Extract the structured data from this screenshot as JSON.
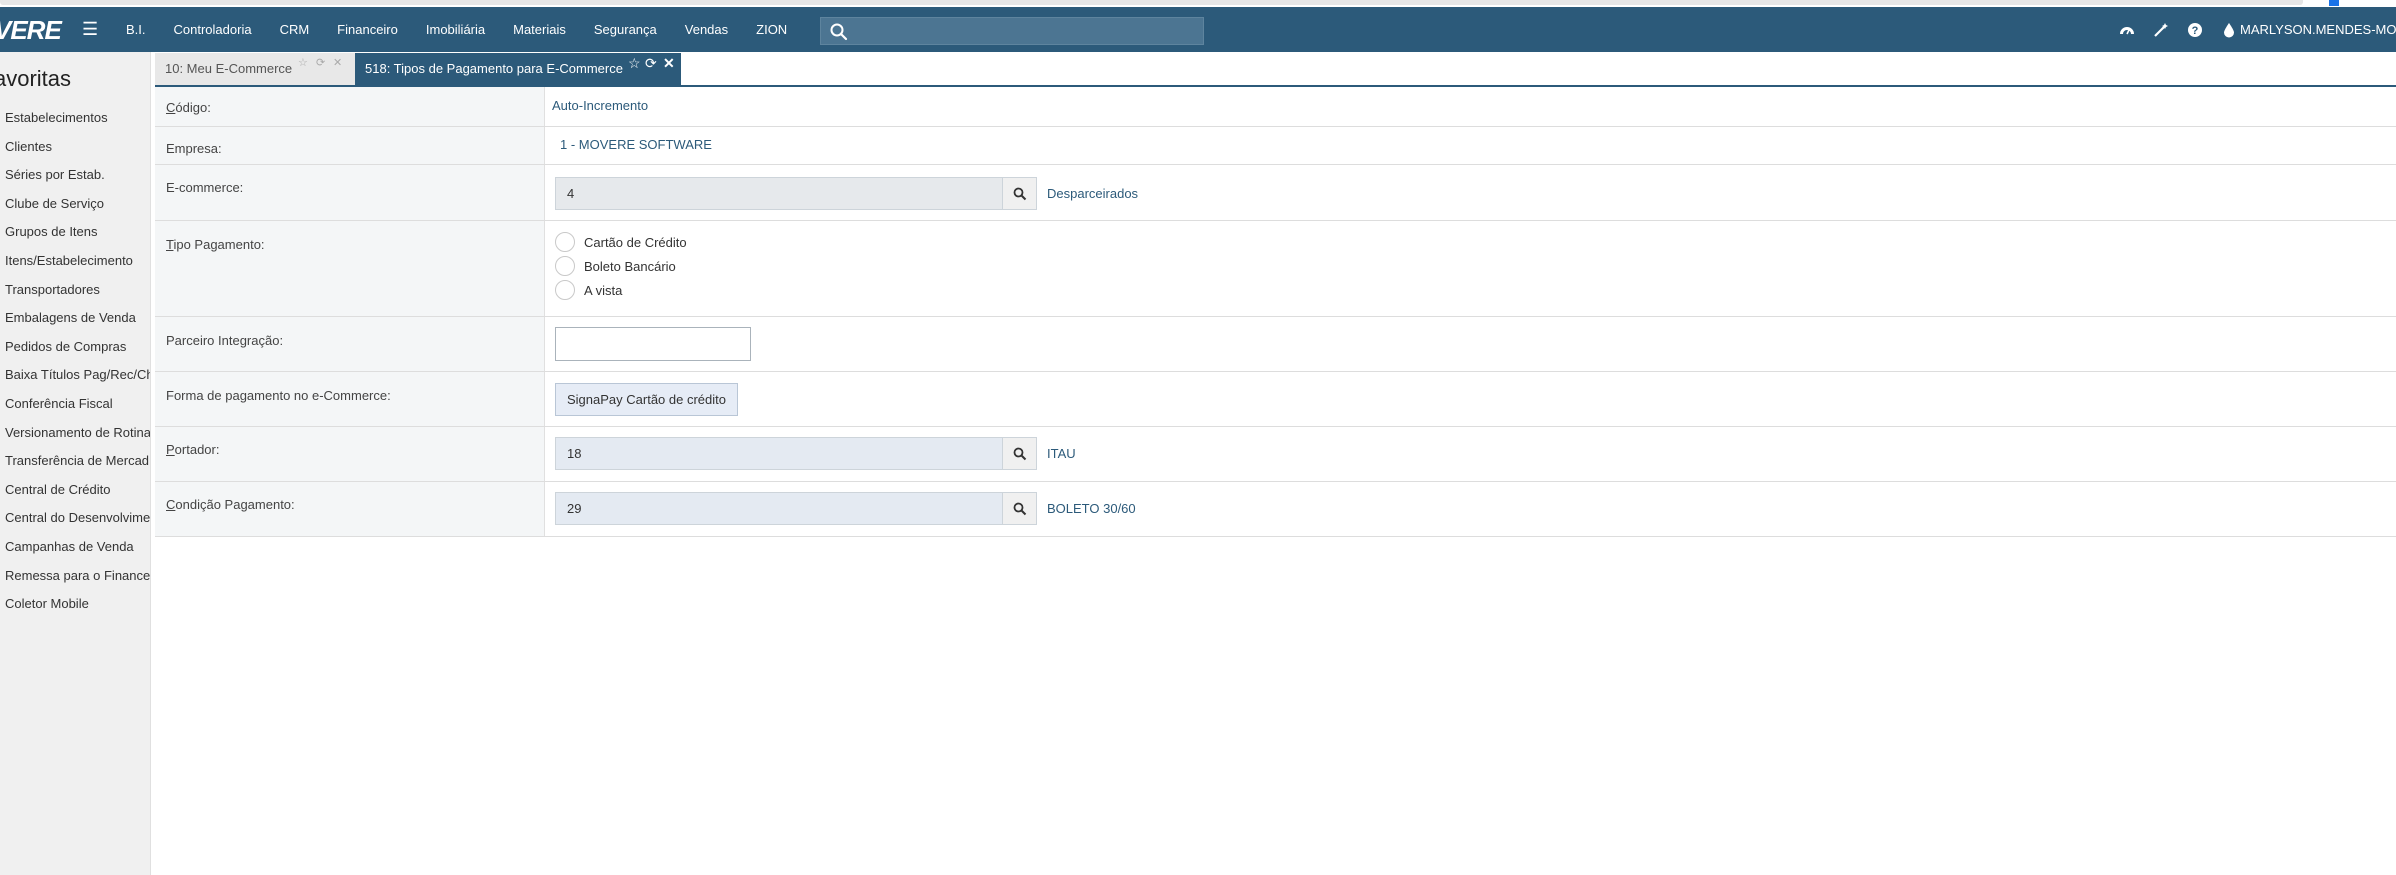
{
  "topbar": {
    "logo": "VERE",
    "menu": [
      "B.I.",
      "Controladoria",
      "CRM",
      "Financeiro",
      "Imobiliária",
      "Materiais",
      "Segurança",
      "Vendas",
      "ZION"
    ],
    "search_placeholder": "",
    "icons": [
      "dashboard-icon",
      "magic-wand-icon",
      "help-icon",
      "water-drop-icon"
    ],
    "user": "MARLYSON.MENDES-MO"
  },
  "sidebar": {
    "title": "avoritas",
    "items": [
      "Estabelecimentos",
      "Clientes",
      "Séries por Estab.",
      "Clube de Serviço",
      "Grupos de Itens",
      "Itens/Estabelecimento",
      "Transportadores",
      "Embalagens de Venda",
      "Pedidos de Compras",
      "Baixa Títulos Pag/Rec/Ch",
      "Conferência Fiscal",
      "Versionamento de Rotina",
      "Transferência de Mercad",
      "Central de Crédito",
      "Central do Desenvolvime",
      "Campanhas de Venda",
      "Remessa para o Finance",
      "Coletor Mobile"
    ]
  },
  "tabs": [
    {
      "label": "10: Meu E-Commerce",
      "active": false
    },
    {
      "label": "518: Tipos de Pagamento para E-Commerce",
      "active": true
    }
  ],
  "form": {
    "codigo": {
      "label_u": "C",
      "label_rest": "ódigo:",
      "value": "Auto-Incremento"
    },
    "empresa": {
      "label": "Empresa:",
      "value": "1 - MOVERE SOFTWARE"
    },
    "ecommerce": {
      "label": "E-commerce:",
      "value": "4",
      "description": "Desparceirados"
    },
    "tipo_pagamento": {
      "label_u": "T",
      "label_rest": "ipo Pagamento:",
      "options": [
        "Cartão de Crédito",
        "Boleto Bancário",
        "A vista"
      ]
    },
    "parceiro": {
      "label": "Parceiro Integração:",
      "value": ""
    },
    "forma_pagamento": {
      "label": "Forma de pagamento no e-Commerce:",
      "value": "SignaPay Cartão de crédito"
    },
    "portador": {
      "label_u": "P",
      "label_rest": "ortador:",
      "value": "18",
      "description": "ITAU"
    },
    "condicao": {
      "label_u": "C",
      "label_rest": "ondição Pagamento:",
      "value": "29",
      "description": "BOLETO 30/60"
    }
  },
  "colors": {
    "topbar": "#2c5a7a",
    "accent": "#2c5a7a",
    "sidebar": "#f0f0f0"
  }
}
